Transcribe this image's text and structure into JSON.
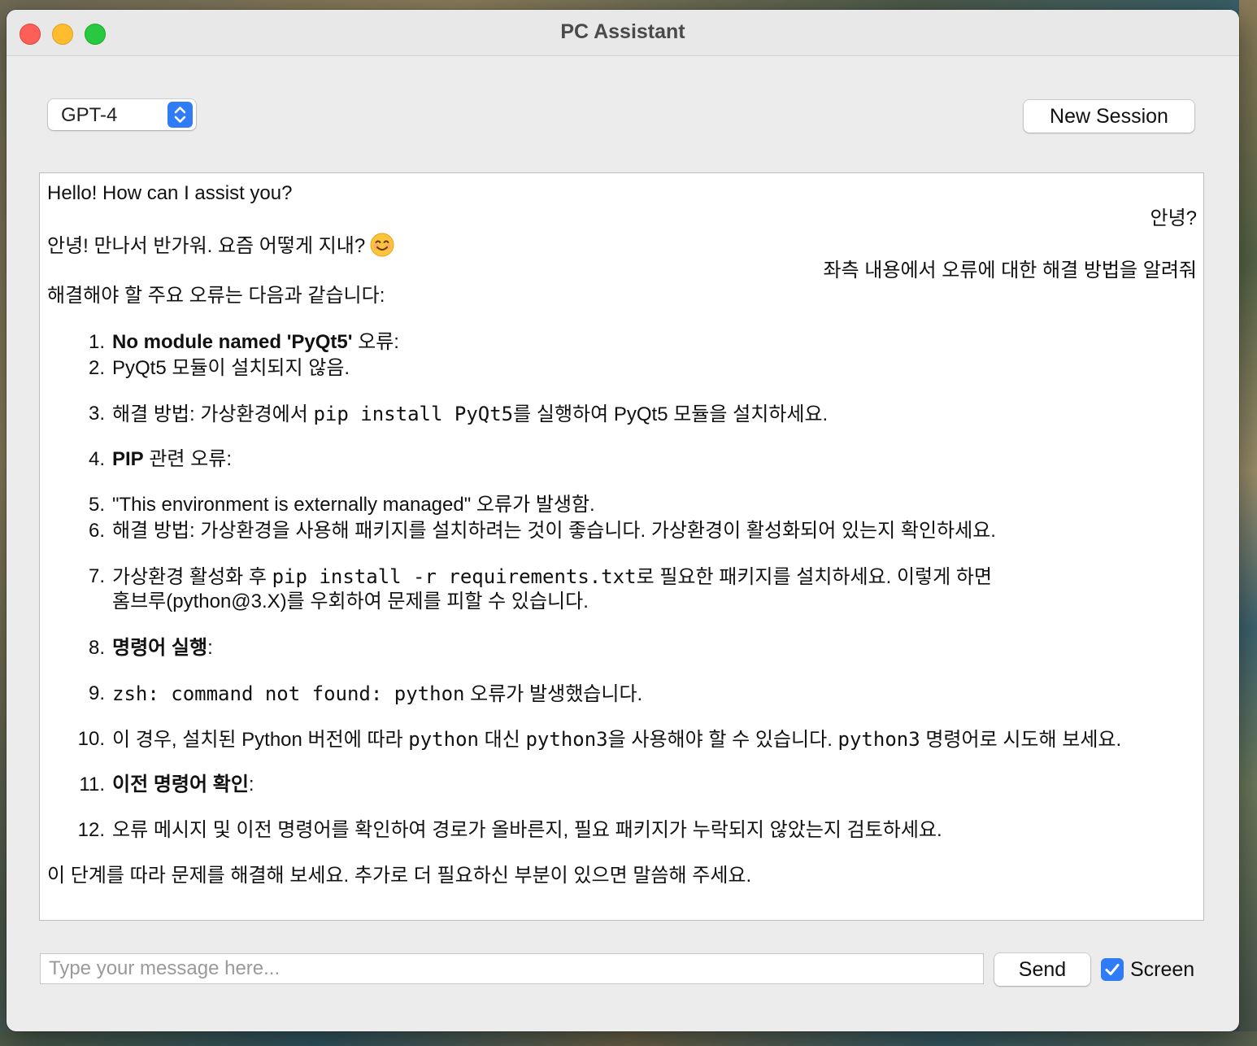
{
  "window": {
    "title": "PC Assistant"
  },
  "toolbar": {
    "model_selected": "GPT-4",
    "new_session_label": "New Session"
  },
  "chat": {
    "greeting": "Hello! How can I assist you?",
    "user_msg_1": "안녕?",
    "assistant_msg_1": "안녕! 만나서 반가워. 요즘 어떻게 지내?",
    "assistant_msg_1_emoji": "smiling-face-emoji",
    "user_msg_2": "좌측 내용에서 오류에 대한 해결 방법을 알려줘",
    "intro": "해결해야 할 주요 오류는 다음과 같습니다:",
    "items": {
      "n1": "1.",
      "i1_bold": "No module named 'PyQt5'",
      "i1_rest": " 오류:",
      "n2": "2.",
      "i2": "PyQt5 모듈이 설치되지 않음.",
      "n3": "3.",
      "i3_a": "해결 방법: 가상환경에서 ",
      "i3_code": "pip install PyQt5",
      "i3_b": "를 실행하여 PyQt5 모듈을 설치하세요.",
      "n4": "4.",
      "i4_bold": "PIP",
      "i4_rest": " 관련 오류",
      "i4_colon": ":",
      "n5": "5.",
      "i5": "\"This environment is externally managed\" 오류가 발생함.",
      "n6": "6.",
      "i6": "해결 방법: 가상환경을 사용해 패키지를 설치하려는 것이 좋습니다. 가상환경이 활성화되어 있는지 확인하세요.",
      "n7": "7.",
      "i7_a": "가상환경 활성화 후 ",
      "i7_code": "pip install -r requirements.txt",
      "i7_b": "로 필요한 패키지를 설치하세요. 이렇게 하면",
      "i7_line2": "홈브루(python@3.X)를 우회하여 문제를 피할 수 있습니다.",
      "n8": "8.",
      "i8_bold": "명령어 실행",
      "i8_colon": ":",
      "n9": "9.",
      "i9_code": "zsh: command not found: python",
      "i9_rest": " 오류가 발생했습니다.",
      "n10": "10.",
      "i10_a": "이 경우, 설치된 Python 버전에 따라 ",
      "i10_code1": "python",
      "i10_b": " 대신 ",
      "i10_code2": "python3",
      "i10_c": "을 사용해야 할 수 있습니다. ",
      "i10_code3": "python3",
      "i10_d": " 명령어로 시도해 보세요.",
      "n11": "11.",
      "i11_bold": "이전 명령어 확인",
      "i11_colon": ":",
      "n12": "12.",
      "i12": "오류 메시지 및 이전 명령어를 확인하여 경로가 올바른지, 필요 패키지가 누락되지 않았는지 검토하세요."
    },
    "closing": "이 단계를 따라 문제를 해결해 보세요. 추가로 더 필요하신 부분이 있으면 말씀해 주세요."
  },
  "composer": {
    "input_value": "",
    "input_placeholder": "Type your message here...",
    "send_label": "Send",
    "screen_label": "Screen",
    "screen_checked": true
  },
  "colors": {
    "accent": "#2f7cf6",
    "close": "#fe5f57",
    "minimize": "#febc2e",
    "maximize": "#28c840"
  }
}
